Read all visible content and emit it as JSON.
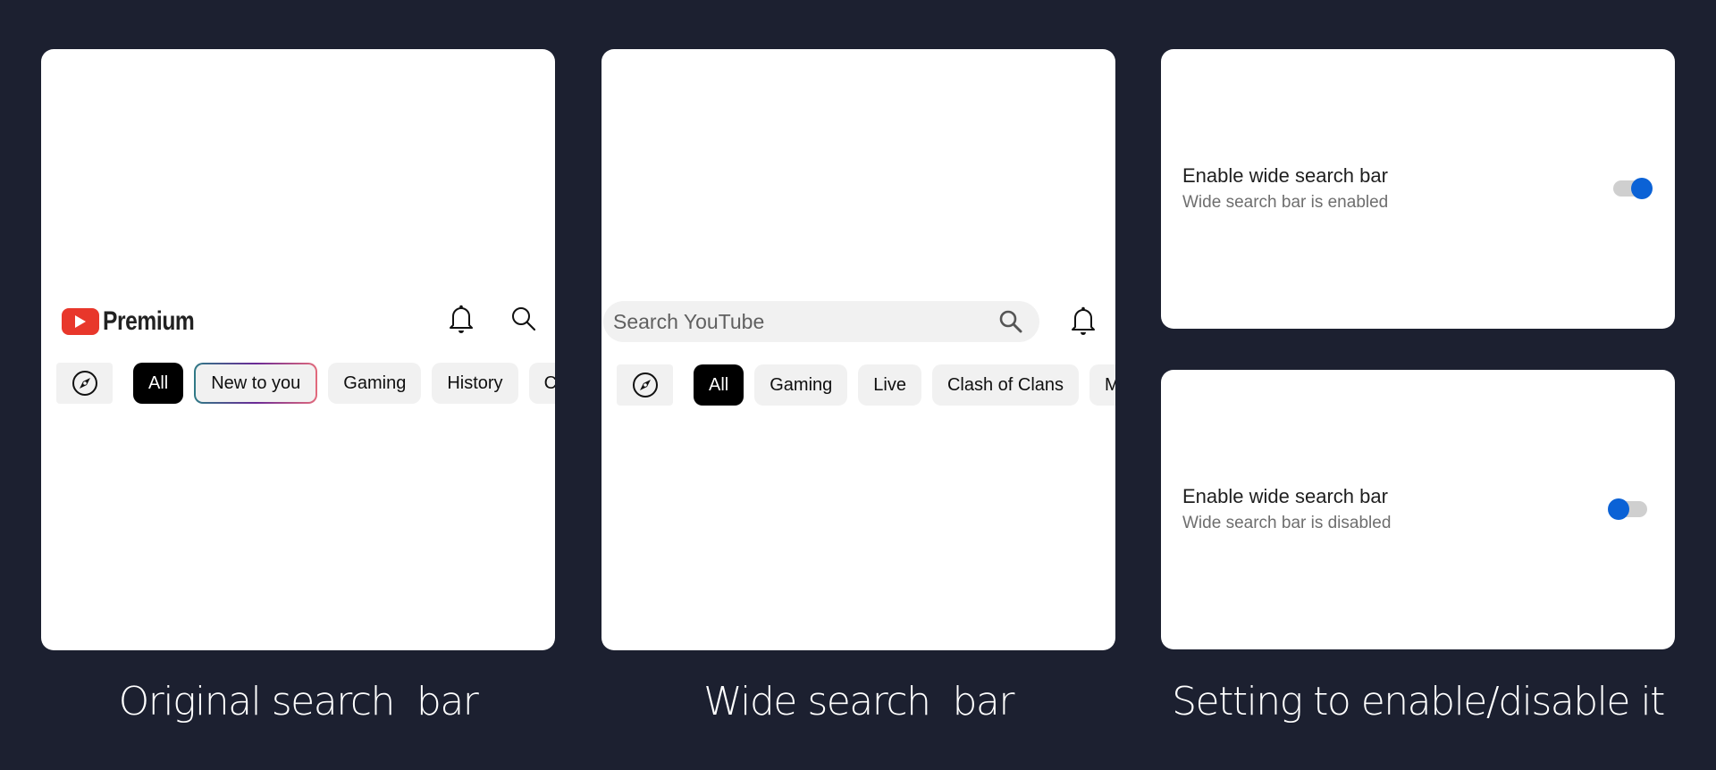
{
  "panels": [
    {
      "id": "original",
      "caption": "Original search  bar",
      "header": {
        "logo_text": "Premium",
        "icons": [
          "bell-icon",
          "search-icon"
        ]
      },
      "chips": [
        {
          "type": "icon",
          "icon": "compass-icon"
        },
        {
          "label": "All",
          "state": "active"
        },
        {
          "label": "New to you",
          "state": "gradient-outline"
        },
        {
          "label": "Gaming"
        },
        {
          "label": "History"
        },
        {
          "label": "C",
          "clipped": true
        }
      ]
    },
    {
      "id": "wide",
      "caption": "Wide search  bar",
      "search": {
        "placeholder": "Search YouTube",
        "icons": [
          "search-icon",
          "bell-icon"
        ]
      },
      "chips": [
        {
          "type": "icon",
          "icon": "compass-icon"
        },
        {
          "label": "All",
          "state": "active"
        },
        {
          "label": "Gaming"
        },
        {
          "label": "Live"
        },
        {
          "label": "Clash of Clans"
        },
        {
          "label": "M",
          "clipped": true
        }
      ]
    },
    {
      "id": "setting",
      "caption": "Setting to enable/disable it",
      "settings": [
        {
          "title": "Enable wide search bar",
          "subtitle": "Wide search bar is enabled",
          "enabled": true
        },
        {
          "title": "Enable wide search bar",
          "subtitle": "Wide search bar is disabled",
          "enabled": false
        }
      ]
    }
  ],
  "colors": {
    "background": "#1c2030",
    "youtube_red": "#e8372b",
    "toggle_blue": "#0b62d6",
    "chip_bg": "#f1f1f1",
    "chip_active": "#000000"
  }
}
